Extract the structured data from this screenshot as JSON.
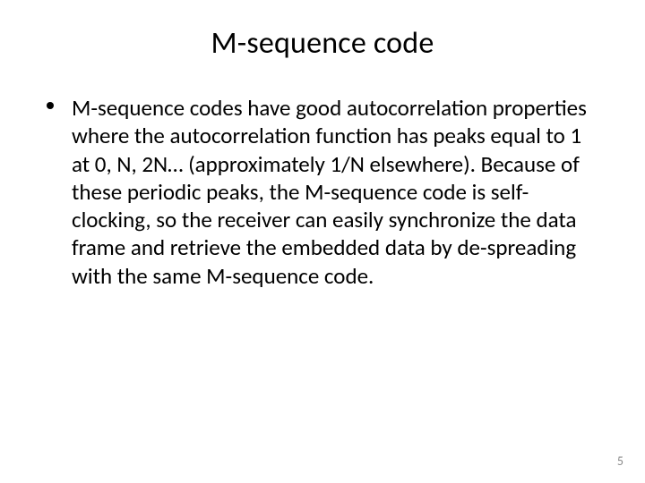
{
  "slide": {
    "title": "M-sequence code",
    "bullets": [
      "M-sequence codes have good autocorrelation properties where the autocorrelation function has peaks equal to 1 at 0, N, 2N… (approximately 1/N elsewhere). Because of these periodic peaks, the M-sequence code is self-clocking, so the receiver can easily synchronize the data frame and retrieve the embedded data by de-spreading with the same M-sequence code."
    ],
    "page_number": "5"
  }
}
